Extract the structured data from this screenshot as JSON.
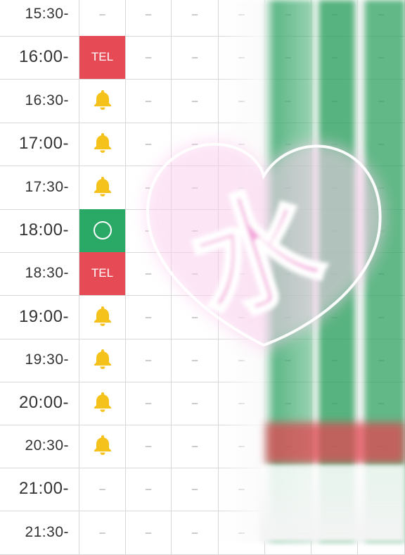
{
  "schedule": {
    "rows": [
      {
        "time": "15:30-",
        "kind": "half",
        "cells": [
          "–",
          "–",
          "–",
          "–",
          "–",
          "–",
          "–"
        ]
      },
      {
        "time": "16:00-",
        "kind": "hour",
        "cells": [
          "TEL",
          "–",
          "–",
          "–",
          "–",
          "–",
          "–"
        ]
      },
      {
        "time": "16:30-",
        "kind": "half",
        "cells": [
          "bell",
          "–",
          "–",
          "–",
          "–",
          "–",
          "–"
        ]
      },
      {
        "time": "17:00-",
        "kind": "hour",
        "cells": [
          "bell",
          "–",
          "–",
          "–",
          "–",
          "–",
          "–"
        ]
      },
      {
        "time": "17:30-",
        "kind": "half",
        "cells": [
          "bell",
          "–",
          "–",
          "–",
          "–",
          "–",
          "–"
        ]
      },
      {
        "time": "18:00-",
        "kind": "hour",
        "cells": [
          "circle",
          "–",
          "–",
          "–",
          "–",
          "–",
          "–"
        ]
      },
      {
        "time": "18:30-",
        "kind": "half",
        "cells": [
          "TEL",
          "–",
          "–",
          "–",
          "–",
          "–",
          "–"
        ]
      },
      {
        "time": "19:00-",
        "kind": "hour",
        "cells": [
          "bell",
          "–",
          "–",
          "–",
          "–",
          "–",
          "–"
        ]
      },
      {
        "time": "19:30-",
        "kind": "half",
        "cells": [
          "bell",
          "–",
          "–",
          "–",
          "–",
          "–",
          "–"
        ]
      },
      {
        "time": "20:00-",
        "kind": "hour",
        "cells": [
          "bell",
          "–",
          "–",
          "–",
          "–",
          "–",
          "–"
        ]
      },
      {
        "time": "20:30-",
        "kind": "half",
        "cells": [
          "bell",
          "–",
          "–",
          "–",
          "–",
          "–",
          "–"
        ]
      },
      {
        "time": "21:00-",
        "kind": "hour",
        "cells": [
          "–",
          "–",
          "–",
          "–",
          "–",
          "–",
          "–"
        ]
      },
      {
        "time": "21:30-",
        "kind": "half",
        "cells": [
          "–",
          "–",
          "–",
          "–",
          "–",
          "–",
          "–"
        ]
      }
    ],
    "colors": {
      "tel": "#e64a55",
      "available": "#2aa866",
      "bell": "#f4c21b",
      "grid": "#d8d8d8"
    },
    "icons": {
      "bell": "bell-icon",
      "circle": "available-circle-icon"
    }
  },
  "overlay": {
    "stamp_text": "水",
    "heart_color": "#ffffff",
    "glow_color": "#f7a8dd"
  }
}
